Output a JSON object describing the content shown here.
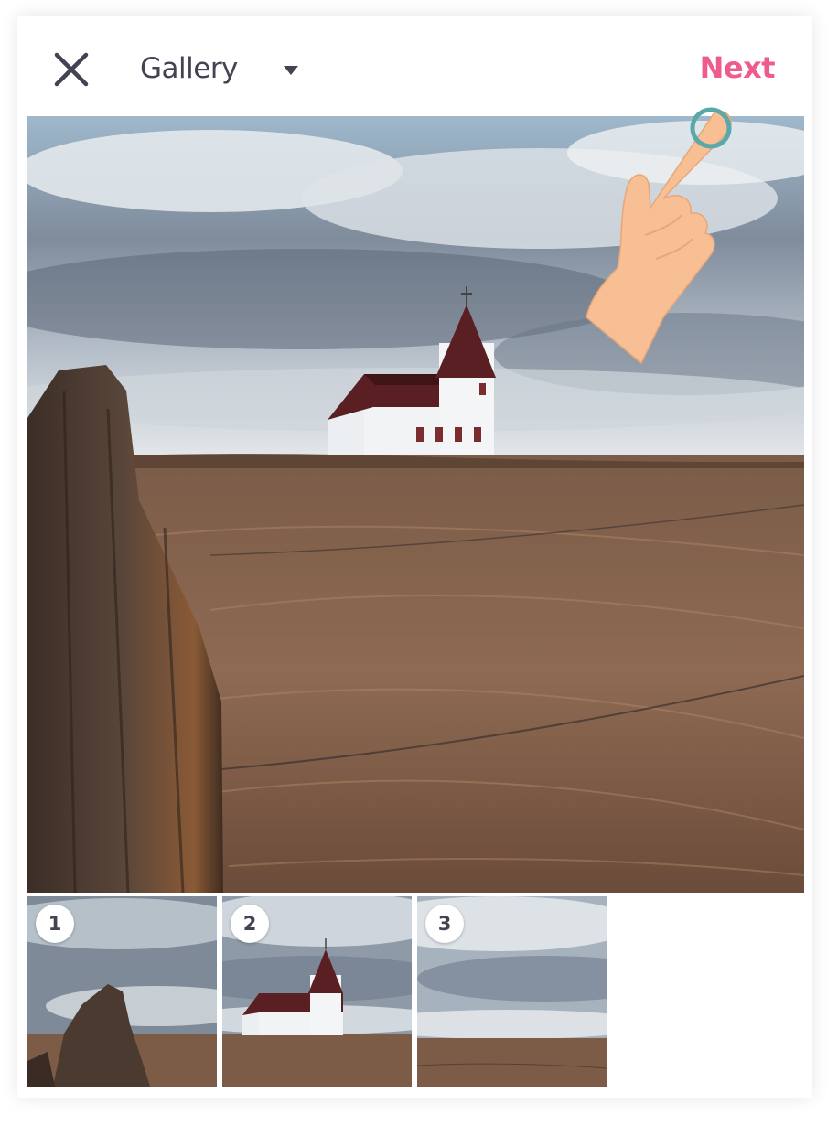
{
  "header": {
    "close_icon": "close-icon",
    "title": "Gallery",
    "dropdown_icon": "caret-down-icon",
    "next_label": "Next"
  },
  "colors": {
    "accent": "#ee5c8e",
    "text": "#434354",
    "tap_ring": "#5aa8a8"
  },
  "thumbnails": [
    {
      "number": "1"
    },
    {
      "number": "2"
    },
    {
      "number": "3"
    }
  ],
  "overlay": {
    "hand_icon": "pointing-hand-icon",
    "tap_indicator": "tap-ring"
  }
}
